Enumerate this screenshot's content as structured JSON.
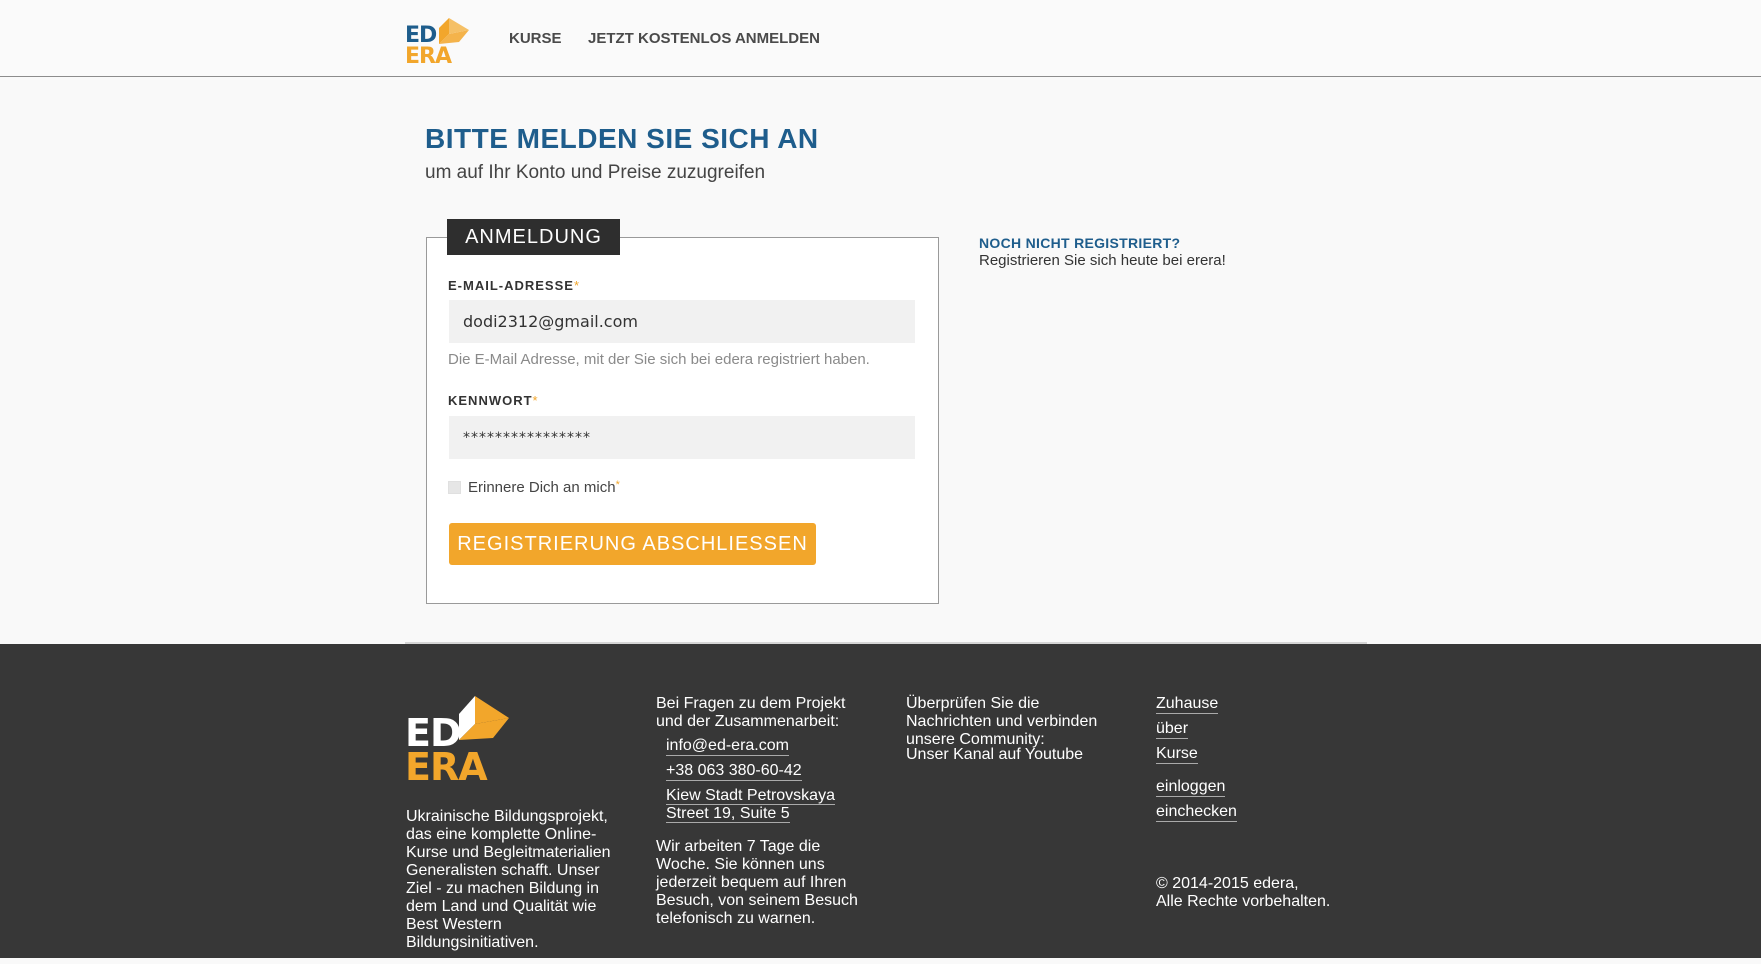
{
  "header": {
    "logo": {
      "line1": "ED",
      "line2": "ERA"
    },
    "nav": [
      "KURSE",
      "JETZT KOSTENLOS ANMELDEN"
    ]
  },
  "main": {
    "title": "BITTE MELDEN SIE SICH AN",
    "subtitle": "um auf Ihr Konto und Preise zuzugreifen",
    "form": {
      "legend": "ANMELDUNG",
      "email_label": "E-MAIL-ADRESSE",
      "email_value": "dodi2312@gmail.com",
      "email_hint": "Die E-Mail Adresse, mit der Sie sich bei edera registriert haben.",
      "password_label": "KENNWORT",
      "password_value": "****************",
      "required_mark": "*",
      "remember_label": "Erinnere Dich an mich",
      "submit_label": "REGISTRIERUNG ABSCHLIESSEN"
    },
    "side": {
      "title": "NOCH NICHT REGISTRIERT?",
      "text": "Registrieren Sie sich heute bei erera!"
    }
  },
  "footer": {
    "logo": {
      "line1": "ED",
      "line2": "ERA"
    },
    "description": "Ukrainische Bildungsprojekt, das eine komplette Online-Kurse und Begleitmaterialien Generalisten schafft. Unser Ziel - zu machen Bildung in dem Land und Qualität wie Best Western Bildungsinitiativen.",
    "questions": "Bei Fragen zu dem Projekt und der Zusammenarbeit:",
    "email": "info@ed-era.com",
    "phone": "+38 063 380-60-42",
    "address": "Kiew Stadt Petrovskaya Street 19, Suite 5",
    "hours": "Wir arbeiten 7 Tage die Woche. Sie können uns jederzeit bequem auf Ihren Besuch, von seinem Besuch telefonisch zu warnen.",
    "news": "Überprüfen Sie die Nachrichten und verbinden unsere Community:",
    "youtube": "Unser Kanal auf Youtube",
    "links": [
      "Zuhause",
      "über",
      "Kurse",
      "einloggen",
      "einchecken"
    ],
    "copyright_line1": "©  2014-2015 edera,",
    "copyright_line2": "Alle Rechte vorbehalten."
  },
  "colors": {
    "brand_blue": "#1e5d8c",
    "brand_orange": "#f2a62b",
    "footer_bg": "#373737",
    "legend_bg": "#2e2e2e"
  }
}
